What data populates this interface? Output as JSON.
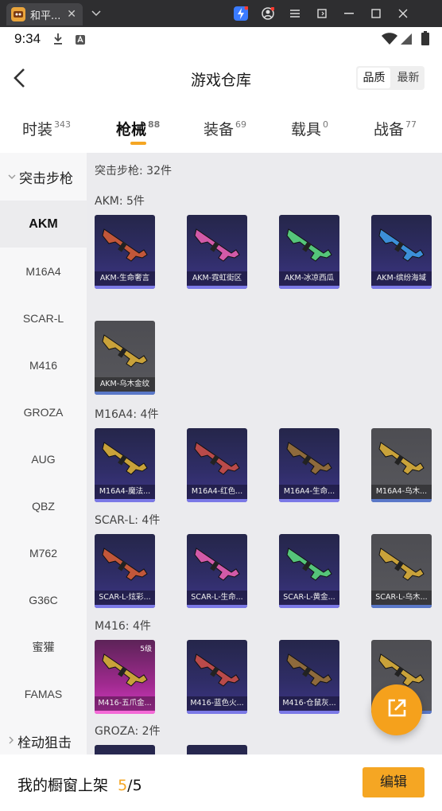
{
  "window": {
    "tab_title": "和平...",
    "close_glyph": "✕",
    "dropdown_glyph": "⌄"
  },
  "status_bar": {
    "time": "9:34"
  },
  "header": {
    "title": "游戏仓库",
    "sort_quality": "品质",
    "sort_latest": "最新"
  },
  "categories": [
    {
      "label": "时装",
      "count": "343"
    },
    {
      "label": "枪械",
      "count": "88"
    },
    {
      "label": "装备",
      "count": "69"
    },
    {
      "label": "载具",
      "count": "0"
    },
    {
      "label": "战备",
      "count": "77"
    }
  ],
  "sidebar": {
    "group_top": "突击步枪",
    "items": [
      "AKM",
      "M16A4",
      "SCAR-L",
      "M416",
      "GROZA",
      "AUG",
      "QBZ",
      "M762",
      "G36C",
      "蜜獾",
      "FAMAS"
    ],
    "group_bottom": "栓动狙击"
  },
  "main": {
    "section_title": "突击步枪: 32件",
    "groups": [
      {
        "title": "AKM: 5件",
        "cards": [
          {
            "label": "AKM-生命奢言",
            "style": "purple"
          },
          {
            "label": "AKM-霓虹街区",
            "style": "purple"
          },
          {
            "label": "AKM-冰凉西瓜",
            "style": "purple"
          },
          {
            "label": "AKM-缤纷海域",
            "style": "purple"
          },
          {
            "label": "AKM-乌木金纹",
            "style": "gray"
          }
        ]
      },
      {
        "title": "M16A4: 4件",
        "cards": [
          {
            "label": "M16A4-魔法...",
            "style": "purple"
          },
          {
            "label": "M16A4-红色...",
            "style": "purple"
          },
          {
            "label": "M16A4-生命...",
            "style": "purple"
          },
          {
            "label": "M16A4-乌木...",
            "style": "gray"
          }
        ]
      },
      {
        "title": "SCAR-L: 4件",
        "cards": [
          {
            "label": "SCAR-L-炫彩...",
            "style": "purple"
          },
          {
            "label": "SCAR-L-生命...",
            "style": "purple"
          },
          {
            "label": "SCAR-L-黄金...",
            "style": "purple"
          },
          {
            "label": "SCAR-L-乌木...",
            "style": "gray"
          }
        ]
      },
      {
        "title": "M416: 4件",
        "cards": [
          {
            "label": "M416-五爪金...",
            "style": "pink",
            "level": "5级"
          },
          {
            "label": "M416-蓝色火...",
            "style": "purple"
          },
          {
            "label": "M416-仓鼠灰...",
            "style": "purple"
          },
          {
            "label": "",
            "style": "gray"
          }
        ]
      },
      {
        "title": "GROZA: 2件",
        "cards": [
          {
            "label": "",
            "style": "purple"
          },
          {
            "label": "",
            "style": "purple"
          }
        ]
      }
    ]
  },
  "bottom_bar": {
    "text": "我的橱窗上架",
    "shown": "5",
    "separator": "/",
    "total": "5",
    "edit_label": "编辑"
  },
  "colors": {
    "accent": "#f5a623",
    "card_purple": "#2f2d66",
    "card_gray": "#58585d",
    "card_pink": "#d43bc3"
  },
  "icons": [
    "back-arrow-icon",
    "share-external-icon",
    "download-icon",
    "wifi-icon",
    "signal-icon",
    "battery-icon"
  ]
}
